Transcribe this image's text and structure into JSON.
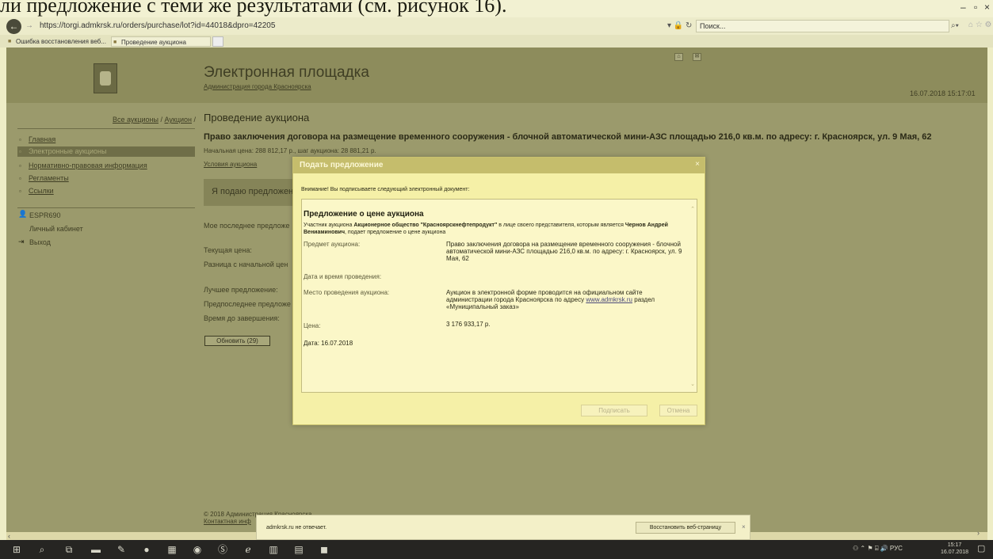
{
  "caption_top": "ли предложение с теми же результатами (см. рисунок 16).",
  "browser": {
    "url": "https://torgi.admkrsk.ru/orders/purchase/lot?id=44018&dpro=42205",
    "search_placeholder": "Поиск...",
    "tabs": [
      {
        "label": "Ошибка восстановления веб..."
      },
      {
        "label": "Проведение аукциона"
      }
    ]
  },
  "site": {
    "title": "Электронная площадка",
    "subtitle": "Администрация города Красноярска",
    "datetime": "16.07.2018 15:17:01"
  },
  "breadcrumb": {
    "root": "Все аукционы",
    "sep": " / ",
    "current": "Аукцион",
    "tail": " /"
  },
  "page_title": "Проведение аукциона",
  "nav": [
    {
      "label": "Главная"
    },
    {
      "label": "Электронные аукционы"
    },
    {
      "label": "Нормативно-правовая информация"
    },
    {
      "label": "Регламенты"
    },
    {
      "label": "Ссылки"
    }
  ],
  "user": {
    "login": "ESPR690",
    "cabinet": "Личный кабинет",
    "logout": "Выход"
  },
  "lot": {
    "title": "Право заключения договора на размещение временного сооружения - блочной автоматической мини-АЗС площадью 216,0 кв.м. по адресу: г. Красноярск, ул. 9 Мая, 62",
    "price_line": "Начальная цена: 288 812,17 р., шаг аукциона: 28 881,21 р.",
    "terms_link": "Условия аукциона",
    "submit_stub": "Я подаю предложен",
    "labels": {
      "my_last": "Мое последнее предложе",
      "current_price": "Текущая цена:",
      "diff": "Разница с начальной цен",
      "best": "Лучшее предложение:",
      "prev": "Предпоследнее предложе",
      "time_left": "Время до завершения:"
    },
    "refresh": "Обновить (29)"
  },
  "footer": {
    "copyright": "© 2018 Администрация Красноярска",
    "contacts": "Контактная инф"
  },
  "modal": {
    "title": "Подать предложение",
    "warning": "Внимание! Вы подписываете следующий электронный документ:",
    "doc_title": "Предложение о цене аукциона",
    "participant_pre": "Участник аукциона ",
    "participant_org": "Акционерное общество \"Красноярскнефтепродукт\"",
    "participant_mid": " в лице своего представителя, которым является ",
    "participant_rep": "Чернов Андрей Вениаминович",
    "participant_post": ", подает предложение о цене аукциона",
    "subject_label": "Предмет аукциона:",
    "subject_value": "Право заключения договора на размещение временного сооружения - блочной автоматической мини-АЗС площадью 216,0 кв.м. по адресу: г. Красноярск, ул. 9 Мая, 62",
    "datetime_label": "Дата и время проведения:",
    "place_label": "Место проведения аукциона:",
    "place_value_pre": "Аукцион в электронной форме проводится на официальном сайте администрации города Красноярска по адресу ",
    "place_link": "www.admkrsk.ru",
    "place_value_post": " раздел «Муниципальный заказ»",
    "price_label": "Цена:",
    "price_value": "3 176 933,17 р.",
    "date_line": "Дата: 16.07.2018",
    "sign_button": "Подписать",
    "cancel_button": "Отмена"
  },
  "notification": {
    "text": "admkrsk.ru не отвечает.",
    "button": "Восстановить веб-страницу"
  },
  "taskbar": {
    "lang": "РУС",
    "time": "15:17",
    "date": "16.07.2018"
  }
}
